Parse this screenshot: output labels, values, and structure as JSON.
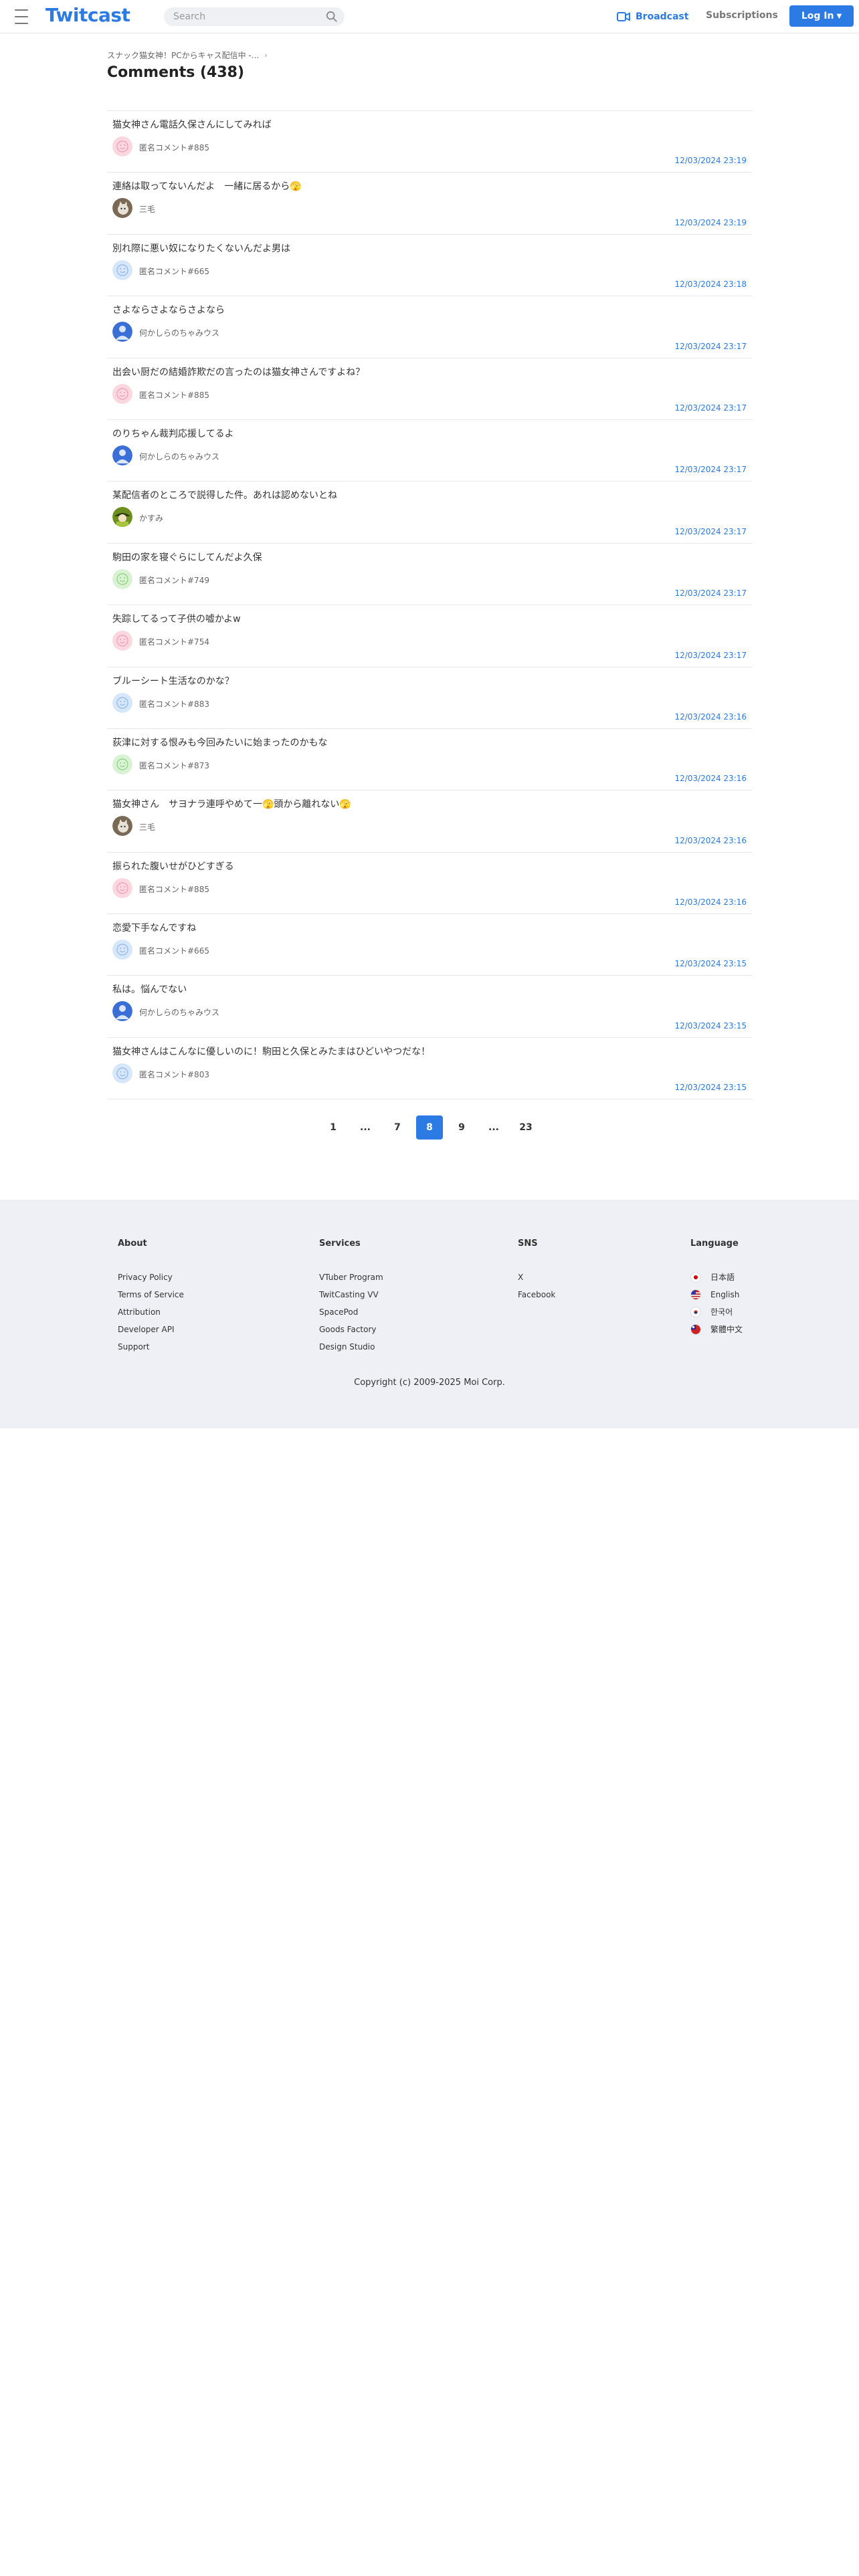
{
  "header": {
    "logo": "Twitcast",
    "search_placeholder": "Search",
    "broadcast_label": "Broadcast",
    "subscriptions_label": "Subscriptions",
    "login_label": "Log In",
    "accent_color": "#2c7be5"
  },
  "breadcrumb": "スナック猫女神！PCからキャス配信中 -...",
  "page_title": "Comments (438)",
  "comments": [
    {
      "text": "猫女神さん電話久保さんにしてみれば",
      "name": "匿名コメント#885",
      "time": "12/03/2024 23:19",
      "avatar": "pink"
    },
    {
      "text": "連絡は取ってないんだよ　一緒に居るから🫣",
      "name": "三毛",
      "time": "12/03/2024 23:19",
      "avatar": "cat"
    },
    {
      "text": "別れ際に悪い奴になりたくないんだよ男は",
      "name": "匿名コメント#665",
      "time": "12/03/2024 23:18",
      "avatar": "blue"
    },
    {
      "text": "さよならさよならさよなら",
      "name": "何かしらのちゃみウス",
      "time": "12/03/2024 23:17",
      "avatar": "person"
    },
    {
      "text": "出会い厨だの結婚詐欺だの言ったのは猫女神さんですよね？",
      "name": "匿名コメント#885",
      "time": "12/03/2024 23:17",
      "avatar": "pink"
    },
    {
      "text": "のりちゃん裁判応援してるよ",
      "name": "何かしらのちゃみウス",
      "time": "12/03/2024 23:17",
      "avatar": "person"
    },
    {
      "text": "某配信者のところで説得した件。あれは認めないとね",
      "name": "かすみ",
      "time": "12/03/2024 23:17",
      "avatar": "green"
    },
    {
      "text": "駒田の家を寝ぐらにしてんだよ久保",
      "name": "匿名コメント#749",
      "time": "12/03/2024 23:17",
      "avatar": "lightgreen"
    },
    {
      "text": "失踪してるって子供の嘘かよw",
      "name": "匿名コメント#754",
      "time": "12/03/2024 23:17",
      "avatar": "pink"
    },
    {
      "text": "ブルーシート生活なのかな？",
      "name": "匿名コメント#883",
      "time": "12/03/2024 23:16",
      "avatar": "blue"
    },
    {
      "text": "荻津に対する恨みも今回みたいに始まったのかもな",
      "name": "匿名コメント#873",
      "time": "12/03/2024 23:16",
      "avatar": "lightgreen"
    },
    {
      "text": "猫女神さん　サヨナラ連呼やめて一🫣頭から離れない🫣",
      "name": "三毛",
      "time": "12/03/2024 23:16",
      "avatar": "cat"
    },
    {
      "text": "振られた腹いせがひどすぎる",
      "name": "匿名コメント#885",
      "time": "12/03/2024 23:16",
      "avatar": "pink"
    },
    {
      "text": "恋愛下手なんですね",
      "name": "匿名コメント#665",
      "time": "12/03/2024 23:15",
      "avatar": "blue"
    },
    {
      "text": "私は。悩んでない",
      "name": "何かしらのちゃみウス",
      "time": "12/03/2024 23:15",
      "avatar": "person"
    },
    {
      "text": "猫女神さんはこんなに優しいのに！駒田と久保とみたまはひどいやつだな！",
      "name": "匿名コメント#803",
      "time": "12/03/2024 23:15",
      "avatar": "blue"
    }
  ],
  "pagination": [
    {
      "label": "1",
      "active": false
    },
    {
      "label": "...",
      "active": false
    },
    {
      "label": "7",
      "active": false
    },
    {
      "label": "8",
      "active": true
    },
    {
      "label": "9",
      "active": false
    },
    {
      "label": "...",
      "active": false
    },
    {
      "label": "23",
      "active": false
    }
  ],
  "footer": {
    "about": {
      "title": "About",
      "links": [
        "Privacy Policy",
        "Terms of Service",
        "Attribution",
        "Developer API",
        "Support"
      ]
    },
    "services": {
      "title": "Services",
      "links": [
        "VTuber Program",
        "TwitCasting VV",
        "SpacePod",
        "Goods Factory",
        "Design Studio"
      ]
    },
    "sns": {
      "title": "SNS",
      "links": [
        "X",
        "Facebook"
      ]
    },
    "language": {
      "title": "Language",
      "links": [
        "日本語",
        "English",
        "한국어",
        "繁體中文"
      ]
    },
    "copyright": "Copyright (c) 2009-2025 Moi Corp."
  }
}
